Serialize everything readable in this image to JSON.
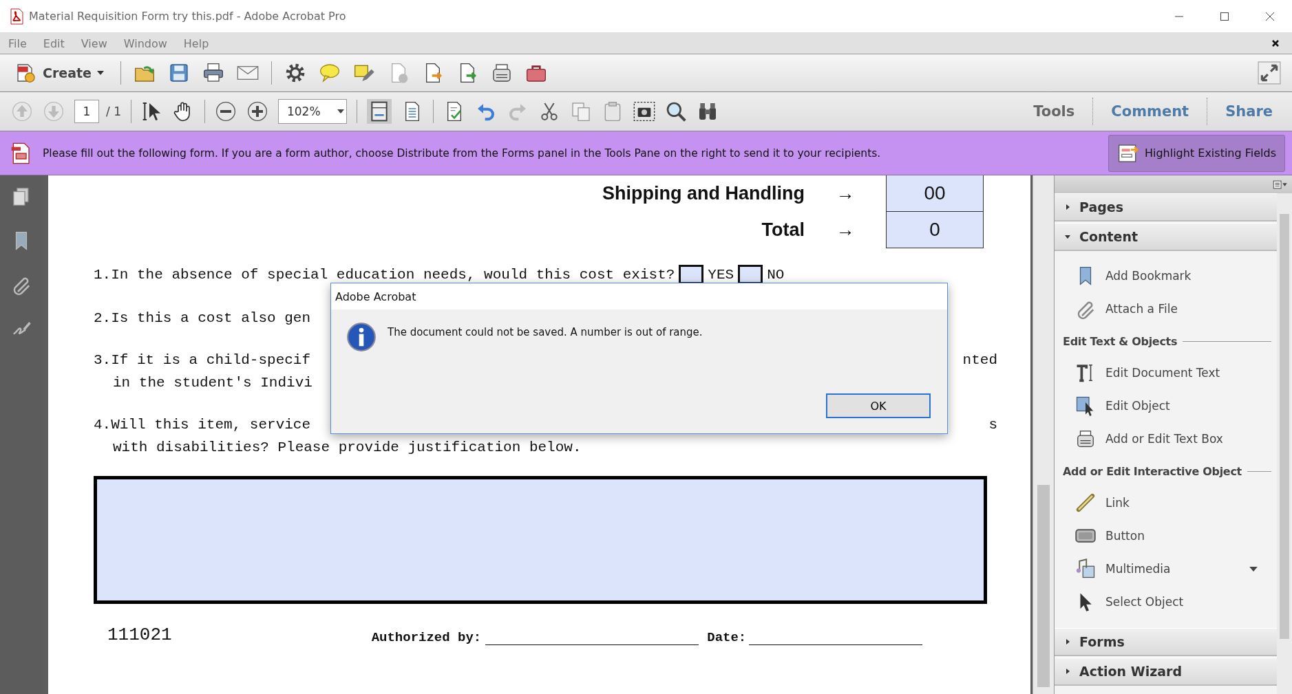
{
  "window": {
    "title": "Material Requisition Form try this.pdf - Adobe Acrobat Pro"
  },
  "menu": [
    {
      "label": "File"
    },
    {
      "label": "Edit"
    },
    {
      "label": "View"
    },
    {
      "label": "Window"
    },
    {
      "label": "Help"
    }
  ],
  "toolbar": {
    "create_label": "Create"
  },
  "nav_toolbar": {
    "page": "1",
    "page_total": "/ 1",
    "zoom": "102%"
  },
  "pane_tabs": [
    {
      "label": "Tools",
      "selected": true
    },
    {
      "label": "Comment",
      "selected": false
    },
    {
      "label": "Share",
      "selected": false
    }
  ],
  "form_bar": {
    "message": "Please fill out the following form. If you are a form author, choose Distribute from the Forms panel in the Tools Pane on the right to send it to your recipients.",
    "button": "Highlight Existing Fields"
  },
  "document": {
    "totals": [
      {
        "label": "Shipping and Handling",
        "arrow": "→",
        "value": "00"
      },
      {
        "label": "Total",
        "arrow": "→",
        "value": "0"
      }
    ],
    "question_1": {
      "text": "1.In the absence of special education needs, would this cost exist?",
      "options": [
        {
          "label": "YES",
          "checked": false
        },
        {
          "label": "NO",
          "checked": false
        }
      ]
    },
    "lines": [
      {
        "kind": "question",
        "left": "2.Is this a cost also gen"
      },
      {
        "kind": "question",
        "left": "3.If it is a child-specif",
        "right": "nted"
      },
      {
        "kind": "continuation",
        "left": "in the student's Indivi"
      },
      {
        "kind": "question",
        "left": "4.Will this item, service",
        "right": "s"
      },
      {
        "kind": "continuation",
        "left": "with disabilities? Please provide justification below."
      }
    ],
    "footer": {
      "code": "111021",
      "authorized_label": "Authorized by:",
      "date_label": "Date:"
    }
  },
  "dialog": {
    "title": "Adobe Acrobat",
    "message": "The document could not be saved. A number is out of range.",
    "button": "OK"
  },
  "tools_pane": {
    "sections": [
      {
        "title": "Pages",
        "expanded": false
      },
      {
        "title": "Content",
        "expanded": true,
        "items": [
          {
            "kind": "tool",
            "label": "Add Bookmark",
            "submenu": false
          },
          {
            "kind": "tool",
            "label": "Attach a File",
            "submenu": false
          },
          {
            "kind": "heading",
            "label": "Edit Text & Objects"
          },
          {
            "kind": "tool",
            "label": "Edit Document Text",
            "submenu": false
          },
          {
            "kind": "tool",
            "label": "Edit Object",
            "submenu": false
          },
          {
            "kind": "tool",
            "label": "Add or Edit Text Box",
            "submenu": false
          },
          {
            "kind": "heading",
            "label": "Add or Edit Interactive Object"
          },
          {
            "kind": "tool",
            "label": "Link",
            "submenu": false
          },
          {
            "kind": "tool",
            "label": "Button",
            "submenu": false
          },
          {
            "kind": "tool",
            "label": "Multimedia",
            "submenu": true
          },
          {
            "kind": "tool",
            "label": "Select Object",
            "submenu": false
          }
        ]
      },
      {
        "title": "Forms",
        "expanded": false
      },
      {
        "title": "Action Wizard",
        "expanded": false
      }
    ]
  }
}
